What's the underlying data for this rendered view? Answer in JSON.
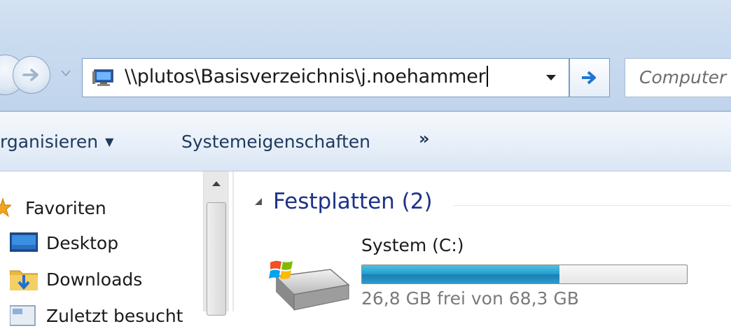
{
  "address_bar": {
    "path": "\\\\plutos\\Basisverzeichnis\\j.noehammer",
    "icon": "computer-icon"
  },
  "search": {
    "placeholder": "Computer"
  },
  "toolbar": {
    "organize_label": "rganisieren",
    "system_properties_label": "Systemeigenschaften",
    "more_label": "»"
  },
  "navigation_pane": {
    "items": [
      {
        "label": "Favoriten",
        "icon": "star-icon"
      },
      {
        "label": "Desktop",
        "icon": "desktop-icon"
      },
      {
        "label": "Downloads",
        "icon": "downloads-folder-icon"
      },
      {
        "label": "Zuletzt besucht",
        "icon": "recent-places-icon"
      }
    ]
  },
  "content": {
    "group_title": "Festplatten (2)",
    "drives": [
      {
        "name": "System (C:)",
        "free_text": "26,8 GB frei von 68,3 GB",
        "used_fraction": 0.608
      }
    ]
  },
  "colors": {
    "accent": "#1e3287",
    "drive_bar": "#26a0d0",
    "toolbar_text": "#1e395b"
  }
}
